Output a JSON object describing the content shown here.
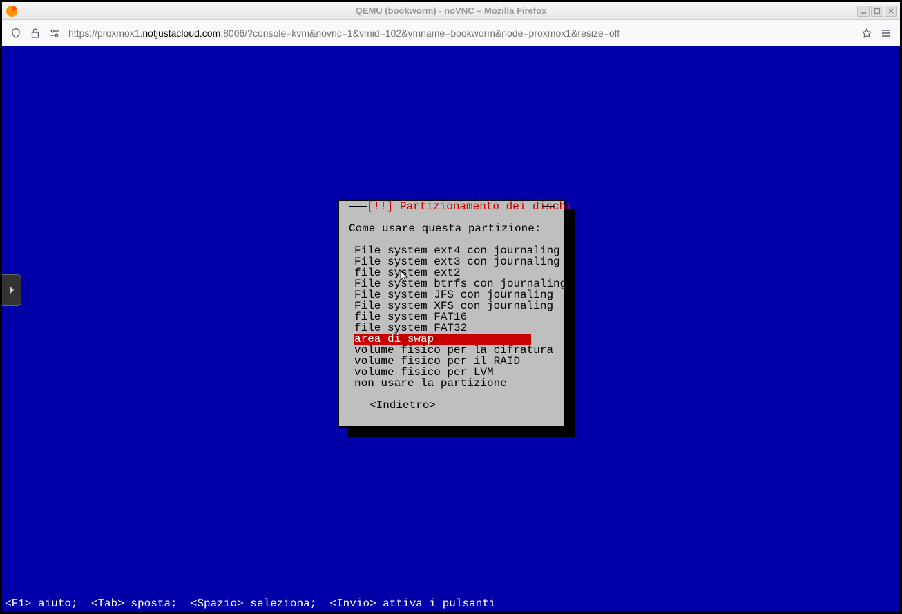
{
  "window": {
    "title": "QEMU (bookworm) - noVNC – Mozilla Firefox"
  },
  "urlbar": {
    "url_pre": "https://proxmox1.",
    "url_domain": "notjustacloud.com",
    "url_post": ":8006/?console=kvm&novnc=1&vmid=102&vmname=bookworm&node=proxmox1&resize=off"
  },
  "dialog": {
    "title": "[!!] Partizionamento dei dischi",
    "prompt": "Come usare questa partizione:",
    "options": [
      "File system ext4 con journaling",
      "File system ext3 con journaling",
      "file system ext2",
      "File system btrfs con journaling",
      "File system JFS con journaling",
      "File system XFS con journaling",
      "file system FAT16",
      "file system FAT32",
      "area di swap",
      "volume fisico per la cifratura",
      "volume fisico per il RAID",
      "volume fisico per LVM",
      "non usare la partizione"
    ],
    "selected_index": 8,
    "back": "<Indietro>"
  },
  "hint": "<F1> aiuto;  <Tab> sposta;  <Spazio> seleziona;  <Invio> attiva i pulsanti"
}
